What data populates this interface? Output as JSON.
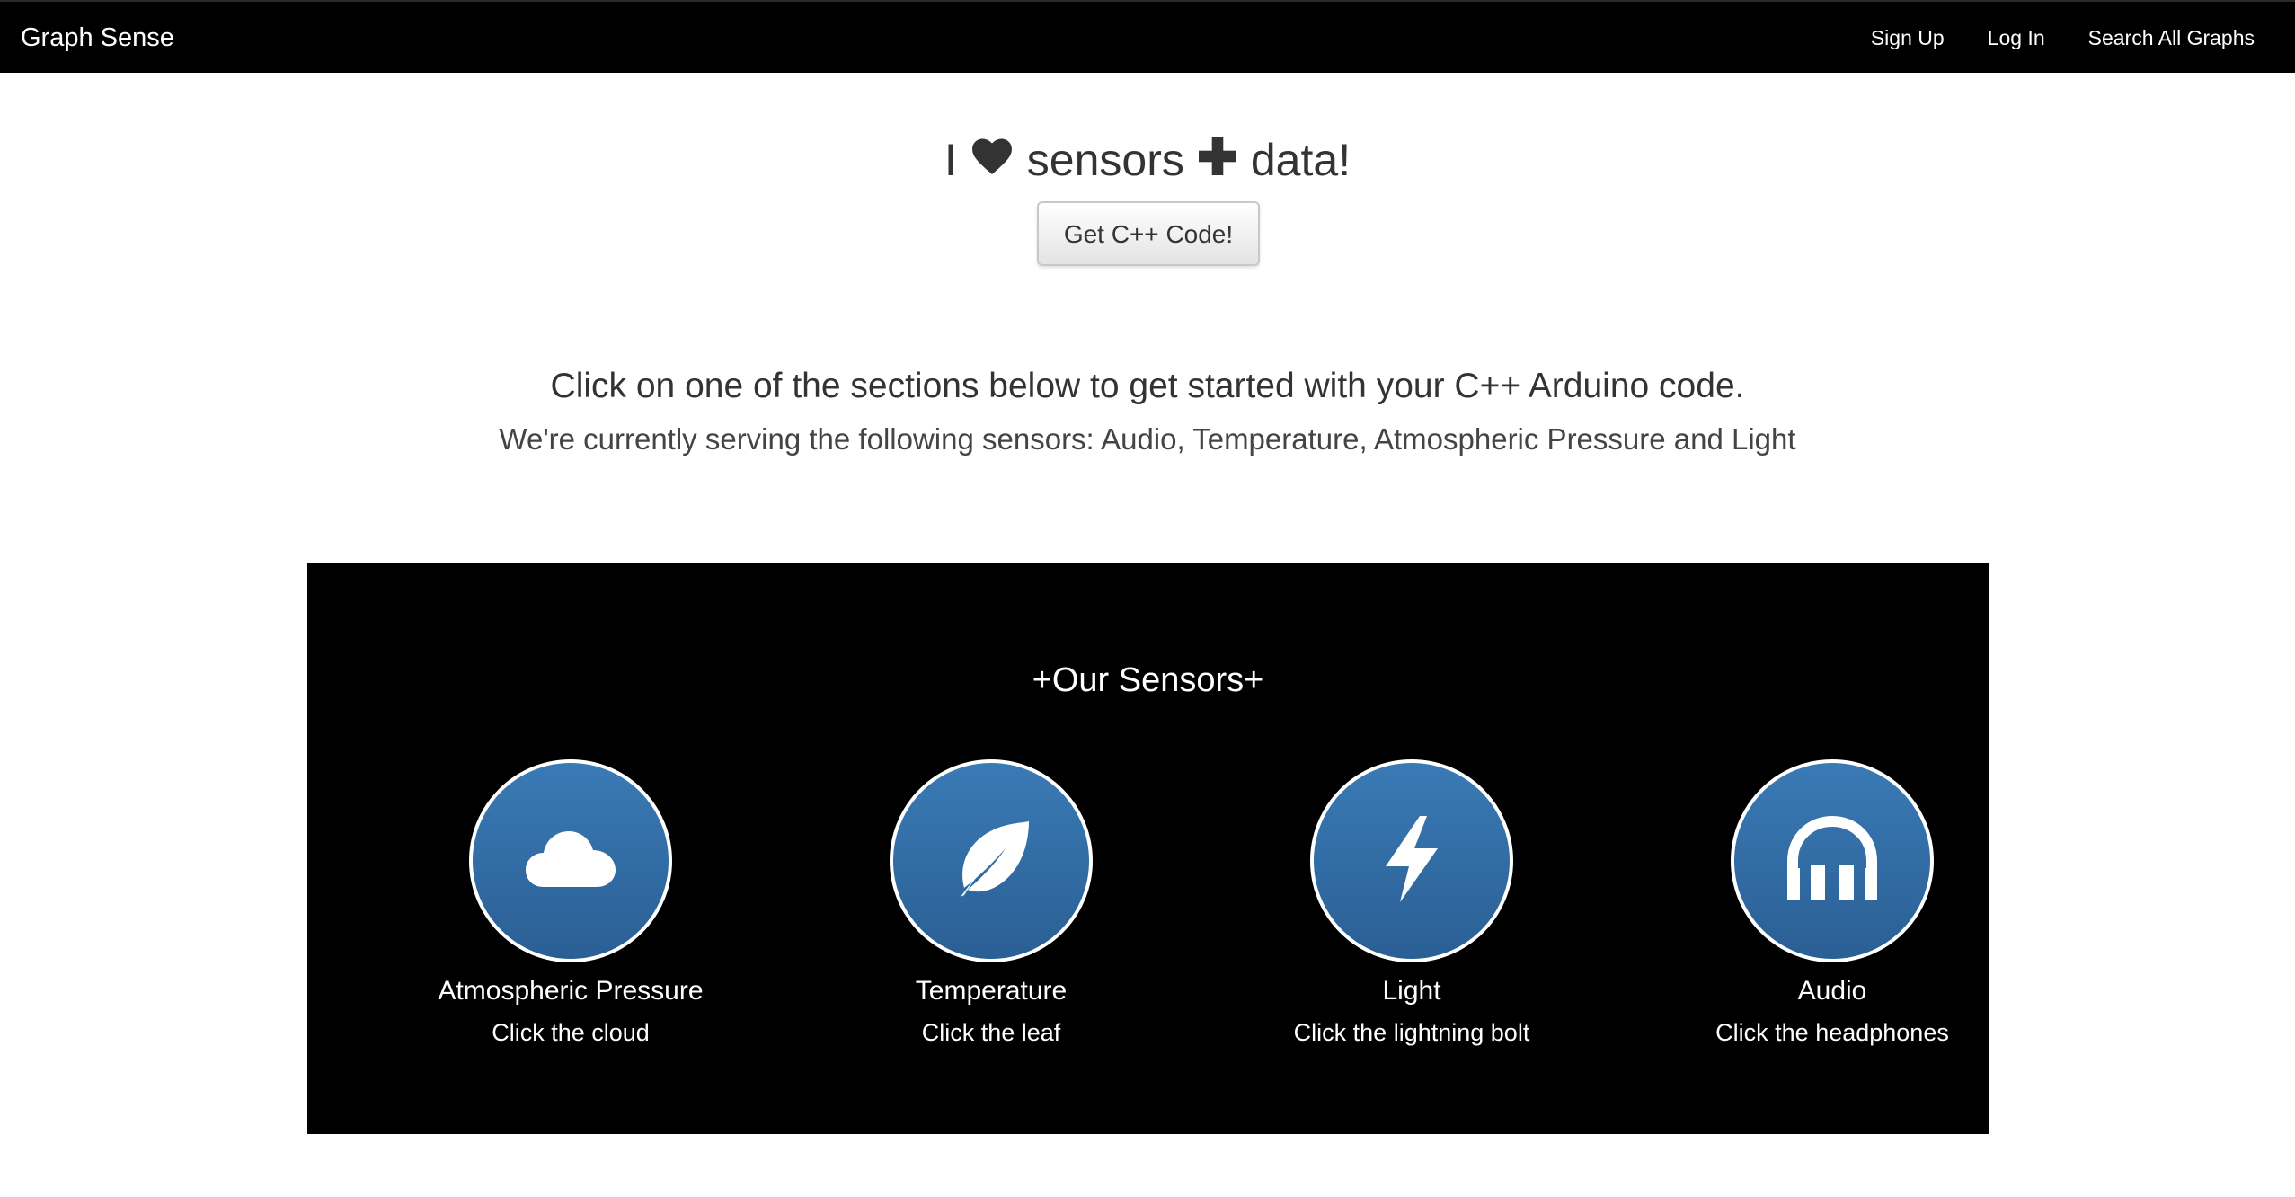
{
  "navbar": {
    "brand": "Graph Sense",
    "links": [
      "Sign Up",
      "Log In",
      "Search All Graphs"
    ]
  },
  "hero": {
    "prefix": "I",
    "middle": "sensors",
    "suffix": "data!",
    "button_label": "Get C++ Code!"
  },
  "intro": {
    "heading": "Click on one of the sections below to get started with your C++ Arduino code.",
    "subheading": "We're currently serving the following sensors: Audio, Temperature, Atmospheric Pressure and Light"
  },
  "sensors": {
    "title": "+Our Sensors+",
    "items": [
      {
        "name": "Atmospheric Pressure",
        "hint": "Click the cloud",
        "icon": "cloud-icon"
      },
      {
        "name": "Temperature",
        "hint": "Click the leaf",
        "icon": "leaf-icon"
      },
      {
        "name": "Light",
        "hint": "Click the lightning bolt",
        "icon": "lightning-bolt-icon"
      },
      {
        "name": "Audio",
        "hint": "Click the headphones",
        "icon": "headphones-icon"
      }
    ]
  },
  "colors": {
    "navbar": "#000000",
    "panel": "#000000",
    "circle_top": "#3a7ab5",
    "circle_bottom": "#2a5f94",
    "text_dark": "#333333"
  }
}
